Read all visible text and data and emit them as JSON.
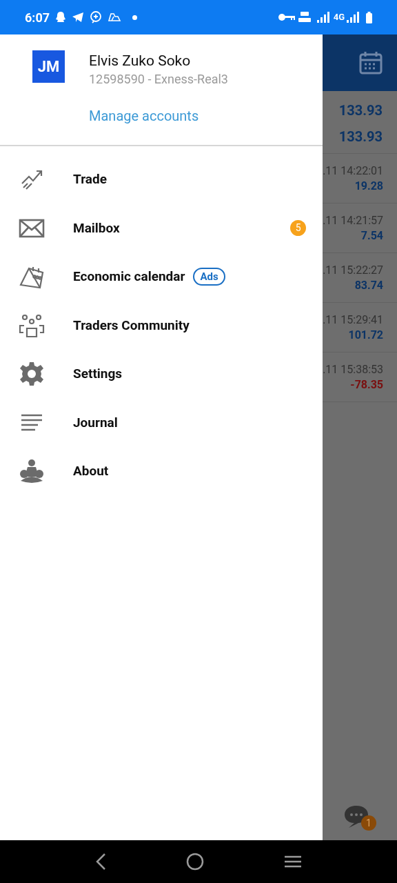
{
  "status_bar": {
    "time": "6:07",
    "network_type": "4G"
  },
  "account": {
    "initials": "JM",
    "name": "Elvis Zuko Soko",
    "login": "12598590 - Exness-Real3",
    "manage": "Manage accounts"
  },
  "menu": [
    {
      "kind": "trade",
      "label": "Trade"
    },
    {
      "kind": "mail",
      "label": "Mailbox",
      "badge": "5"
    },
    {
      "kind": "calendar",
      "label": "Economic calendar",
      "tag": "Ads"
    },
    {
      "kind": "community",
      "label": "Traders Community"
    },
    {
      "kind": "settings",
      "label": "Settings"
    },
    {
      "kind": "journal",
      "label": "Journal"
    },
    {
      "kind": "about",
      "label": "About"
    }
  ],
  "background": {
    "prices": [
      "133.93",
      "133.93"
    ],
    "deals": [
      {
        "time": ".11 14:22:01",
        "profit": "19.28",
        "negative": false
      },
      {
        "time": ".11 14:21:57",
        "profit": "7.54",
        "negative": false
      },
      {
        "time": ".11 15:22:27",
        "profit": "83.74",
        "negative": false
      },
      {
        "time": ".11 15:29:41",
        "profit": "101.72",
        "negative": false
      },
      {
        "time": ".11 15:38:53",
        "profit": "-78.35",
        "negative": true
      }
    ],
    "chat_badge": "1"
  }
}
